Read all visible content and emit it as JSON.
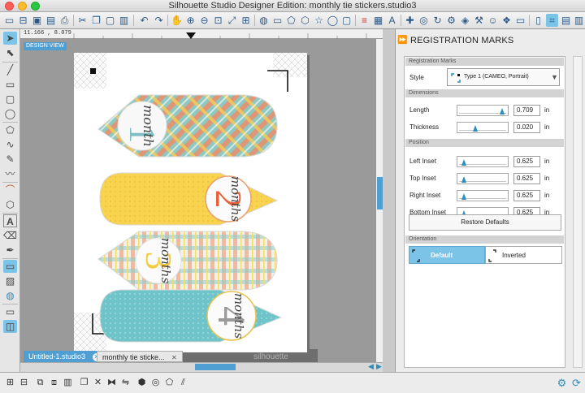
{
  "window": {
    "title": "Silhouette Studio Designer Edition: monthly tie stickers.studio3"
  },
  "toolbar": {
    "icons": [
      "new-icon",
      "open-icon",
      "save-icon",
      "library-icon",
      "print-icon",
      "cut-icon",
      "copy-icon",
      "paste-icon",
      "undo-icon",
      "redo-icon",
      "pan-icon",
      "zoom-in-icon",
      "zoom-out-icon",
      "zoom-select-icon",
      "fit-icon",
      "zoom-page-icon",
      "fill-icon",
      "line-color-icon",
      "shape-icon",
      "text-style-icon",
      "align-icon",
      "replicate-icon",
      "modify-icon",
      "offset-icon",
      "trace-icon",
      "page-setup-icon",
      "cut-settings-icon"
    ]
  },
  "canvas": {
    "coords": "11.166 , 8.079",
    "view_label": "DESIGN VIEW",
    "watermark": "silhouette",
    "stickers": [
      {
        "numeral": "1",
        "word": "month",
        "colors": [
          "#7fbfc3",
          "#f3845c",
          "#f6cf55"
        ]
      },
      {
        "numeral": "2",
        "word": "months",
        "colors": [
          "#f7d650",
          "#f0c538",
          "#e8603c"
        ]
      },
      {
        "numeral": "3",
        "word": "months",
        "colors": [
          "#8ecdc9",
          "#f08c63",
          "#f2dd6b"
        ]
      },
      {
        "numeral": "4",
        "word": "months",
        "colors": [
          "#6ec4c8",
          "#7ecfd1",
          "#aaaaaa"
        ]
      }
    ]
  },
  "tabs": [
    {
      "label": "Untitled-1.studio3",
      "active": true
    },
    {
      "label": "monthly tie sticke...",
      "active": false
    }
  ],
  "panel": {
    "title": "REGISTRATION MARKS",
    "sections": {
      "reg": "Registration Marks",
      "dim": "Dimensions",
      "pos": "Position",
      "ori": "Orientation"
    },
    "style": {
      "label": "Style",
      "value": "Type 1 (CAMEO, Portrait)"
    },
    "fields": [
      {
        "key": "length",
        "label": "Length",
        "value": "0.709",
        "unit": "in",
        "level": 0.9
      },
      {
        "key": "thickness",
        "label": "Thickness",
        "value": "0.020",
        "unit": "in",
        "level": 0.3
      },
      {
        "key": "left_inset",
        "label": "Left Inset",
        "value": "0.625",
        "unit": "in",
        "level": 0.05
      },
      {
        "key": "top_inset",
        "label": "Top Inset",
        "value": "0.625",
        "unit": "in",
        "level": 0.05
      },
      {
        "key": "right_inset",
        "label": "Right Inset",
        "value": "0.625",
        "unit": "in",
        "level": 0.05
      },
      {
        "key": "bottom_inset",
        "label": "Bottom Inset",
        "value": "0.625",
        "unit": "in",
        "level": 0.05
      }
    ],
    "restore_label": "Restore Defaults",
    "orientation": {
      "default": "Default",
      "inverted": "Inverted",
      "selected": "default"
    }
  },
  "theme": {
    "accent": "#2d8dbf",
    "selected_blue": "#7cc3e8",
    "panel_bg": "#ececec"
  }
}
